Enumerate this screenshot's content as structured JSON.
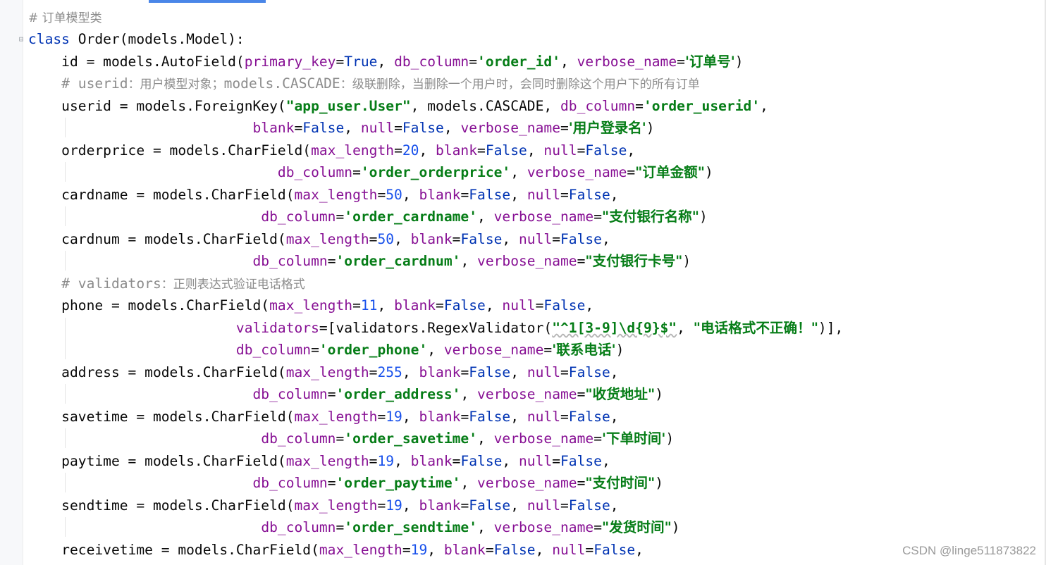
{
  "watermark": "CSDN @linge511873822",
  "code": {
    "l1": "# 订单模型类",
    "l2": {
      "kw": "class",
      "rest": " Order(models.Model):"
    },
    "l3": {
      "a": "    id = models.AutoField(",
      "p1": "primary_key",
      "eq1": "=",
      "v1": "True",
      "c1": ", ",
      "p2": "db_column",
      "eq2": "=",
      "s1": "'order_id'",
      "c2": ", ",
      "p3": "verbose_name",
      "eq3": "=",
      "s2": "'订单号'",
      "e": ")"
    },
    "l4": {
      "a": "    # userid",
      "b": "：用户模型对象；",
      "c": "models.CASCADE",
      "d": "：级联删除，当删除一个用户时，会同时删除这个用户下的所有订单"
    },
    "l5": {
      "a": "    userid = models.ForeignKey(",
      "s1": "\"app_user.User\"",
      "b": ", models.CASCADE, ",
      "p1": "db_column",
      "eq1": "=",
      "s2": "'order_userid'",
      "e": ","
    },
    "l6": {
      "pad": "                           ",
      "p1": "blank",
      "eq1": "=",
      "v1": "False",
      "c1": ", ",
      "p2": "null",
      "eq2": "=",
      "v2": "False",
      "c2": ", ",
      "p3": "verbose_name",
      "eq3": "=",
      "s1": "'用户登录名'",
      "e": ")"
    },
    "l7": {
      "a": "    orderprice = models.CharField(",
      "p1": "max_length",
      "eq1": "=",
      "n1": "20",
      "c1": ", ",
      "p2": "blank",
      "eq2": "=",
      "v1": "False",
      "c2": ", ",
      "p3": "null",
      "eq3": "=",
      "v2": "False",
      "e": ","
    },
    "l8": {
      "pad": "                              ",
      "p1": "db_column",
      "eq1": "=",
      "s1": "'order_orderprice'",
      "c1": ", ",
      "p2": "verbose_name",
      "eq2": "=",
      "s2": "\"订单金额\"",
      "e": ")"
    },
    "l9": {
      "a": "    cardname = models.CharField(",
      "p1": "max_length",
      "eq1": "=",
      "n1": "50",
      "c1": ", ",
      "p2": "blank",
      "eq2": "=",
      "v1": "False",
      "c2": ", ",
      "p3": "null",
      "eq3": "=",
      "v2": "False",
      "e": ","
    },
    "l10": {
      "pad": "                            ",
      "p1": "db_column",
      "eq1": "=",
      "s1": "'order_cardname'",
      "c1": ", ",
      "p2": "verbose_name",
      "eq2": "=",
      "s2": "\"支付银行名称\"",
      "e": ")"
    },
    "l11": {
      "a": "    cardnum = models.CharField(",
      "p1": "max_length",
      "eq1": "=",
      "n1": "50",
      "c1": ", ",
      "p2": "blank",
      "eq2": "=",
      "v1": "False",
      "c2": ", ",
      "p3": "null",
      "eq3": "=",
      "v2": "False",
      "e": ","
    },
    "l12": {
      "pad": "                           ",
      "p1": "db_column",
      "eq1": "=",
      "s1": "'order_cardnum'",
      "c1": ", ",
      "p2": "verbose_name",
      "eq2": "=",
      "s2": "\"支付银行卡号\"",
      "e": ")"
    },
    "l13": {
      "a": "    # validators",
      "b": "：正则表达式验证电话格式"
    },
    "l14": {
      "a": "    phone = models.CharField(",
      "p1": "max_length",
      "eq1": "=",
      "n1": "11",
      "c1": ", ",
      "p2": "blank",
      "eq2": "=",
      "v1": "False",
      "c2": ", ",
      "p3": "null",
      "eq3": "=",
      "v2": "False",
      "e": ","
    },
    "l15": {
      "pad": "                         ",
      "p1": "validators",
      "eq1": "=",
      "b": "[validators.RegexValidator(",
      "s1": "\"^1[3-9]\\d{9}$\"",
      "c1": ", ",
      "s2": "\"电话格式不正确！\"",
      "e": ")],"
    },
    "l16": {
      "pad": "                         ",
      "p1": "db_column",
      "eq1": "=",
      "s1": "'order_phone'",
      "c1": ", ",
      "p2": "verbose_name",
      "eq2": "=",
      "s2": "'联系电话'",
      "e": ")"
    },
    "l17": {
      "a": "    address = models.CharField(",
      "p1": "max_length",
      "eq1": "=",
      "n1": "255",
      "c1": ", ",
      "p2": "blank",
      "eq2": "=",
      "v1": "False",
      "c2": ", ",
      "p3": "null",
      "eq3": "=",
      "v2": "False",
      "e": ","
    },
    "l18": {
      "pad": "                           ",
      "p1": "db_column",
      "eq1": "=",
      "s1": "'order_address'",
      "c1": ", ",
      "p2": "verbose_name",
      "eq2": "=",
      "s2": "\"收货地址\"",
      "e": ")"
    },
    "l19": {
      "a": "    savetime = models.CharField(",
      "p1": "max_length",
      "eq1": "=",
      "n1": "19",
      "c1": ", ",
      "p2": "blank",
      "eq2": "=",
      "v1": "False",
      "c2": ", ",
      "p3": "null",
      "eq3": "=",
      "v2": "False",
      "e": ","
    },
    "l20": {
      "pad": "                            ",
      "p1": "db_column",
      "eq1": "=",
      "s1": "'order_savetime'",
      "c1": ", ",
      "p2": "verbose_name",
      "eq2": "=",
      "s2": "'下单时间'",
      "e": ")"
    },
    "l21": {
      "a": "    paytime = models.CharField(",
      "p1": "max_length",
      "eq1": "=",
      "n1": "19",
      "c1": ", ",
      "p2": "blank",
      "eq2": "=",
      "v1": "False",
      "c2": ", ",
      "p3": "null",
      "eq3": "=",
      "v2": "False",
      "e": ","
    },
    "l22": {
      "pad": "                           ",
      "p1": "db_column",
      "eq1": "=",
      "s1": "'order_paytime'",
      "c1": ", ",
      "p2": "verbose_name",
      "eq2": "=",
      "s2": "\"支付时间\"",
      "e": ")"
    },
    "l23": {
      "a": "    sendtime = models.CharField(",
      "p1": "max_length",
      "eq1": "=",
      "n1": "19",
      "c1": ", ",
      "p2": "blank",
      "eq2": "=",
      "v1": "False",
      "c2": ", ",
      "p3": "null",
      "eq3": "=",
      "v2": "False",
      "e": ","
    },
    "l24": {
      "pad": "                            ",
      "p1": "db_column",
      "eq1": "=",
      "s1": "'order_sendtime'",
      "c1": ", ",
      "p2": "verbose_name",
      "eq2": "=",
      "s2": "\"发货时间\"",
      "e": ")"
    },
    "l25": {
      "a": "    receivetime = models.CharField(",
      "p1": "max_length",
      "eq1": "=",
      "n1": "19",
      "c1": ", ",
      "p2": "blank",
      "eq2": "=",
      "v1": "False",
      "c2": ", ",
      "p3": "null",
      "eq3": "=",
      "v2": "False",
      "e": ","
    }
  }
}
